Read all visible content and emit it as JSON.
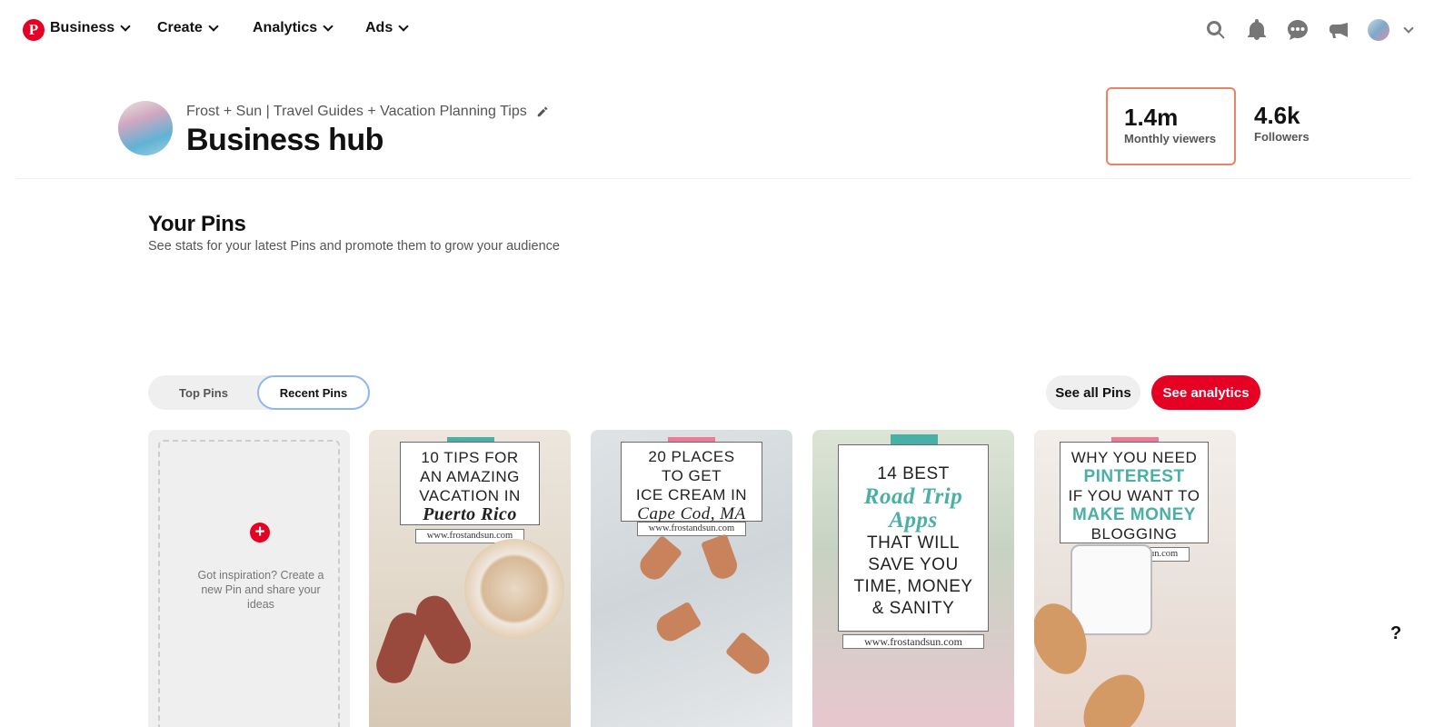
{
  "topnav": {
    "logo_label": "P",
    "items": [
      {
        "label": "Business"
      },
      {
        "label": "Create"
      },
      {
        "label": "Analytics"
      },
      {
        "label": "Ads"
      }
    ],
    "icons": [
      "search-icon",
      "bell-icon",
      "messages-icon",
      "megaphone-icon"
    ]
  },
  "profile": {
    "account_name": "Frost + Sun | Travel Guides + Vacation Planning Tips",
    "title": "Business hub"
  },
  "stats": [
    {
      "value": "1.4m",
      "label": "Monthly viewers"
    },
    {
      "value": "4.6k",
      "label": "Followers"
    }
  ],
  "your_pins": {
    "title": "Your Pins",
    "subtitle": "See stats for your latest Pins and promote them to grow your audience",
    "toggle": {
      "top": "Top Pins",
      "recent": "Recent Pins",
      "selected": "Recent Pins"
    },
    "see_all": "See all Pins",
    "see_analytics": "See analytics"
  },
  "create_pin": {
    "plus": "+",
    "text": "Got inspiration? Create a new Pin and share your ideas"
  },
  "pins": [
    {
      "lines": [
        "10 TIPS FOR",
        "AN AMAZING",
        "VACATION IN",
        "Puerto Rico"
      ],
      "url": "www.frostandsun.com",
      "tape": "#4ab0a5"
    },
    {
      "lines": [
        "20 PLACES",
        "TO GET",
        "ICE CREAM IN",
        "Cape Cod, MA"
      ],
      "url": "www.frostandsun.com",
      "tape": "#ef7a93"
    },
    {
      "lines": [
        "14 BEST",
        "Road Trip",
        "Apps",
        "THAT WILL",
        "SAVE YOU",
        "TIME, MONEY",
        "& SANITY"
      ],
      "url": "www.frostandsun.com",
      "tape": "#4ab0a5"
    },
    {
      "lines": [
        "WHY YOU NEED",
        "PINTEREST",
        "IF YOU WANT TO",
        "MAKE MONEY",
        "BLOGGING"
      ],
      "url": "www.frostandsun.com",
      "tape": "#ef7a93"
    }
  ],
  "help_fab": "?",
  "colors": {
    "brand": "#e60023",
    "highlight": "#ef8166",
    "toggle_focus": "#8fb6ed",
    "teal": "#4ab0a5"
  }
}
